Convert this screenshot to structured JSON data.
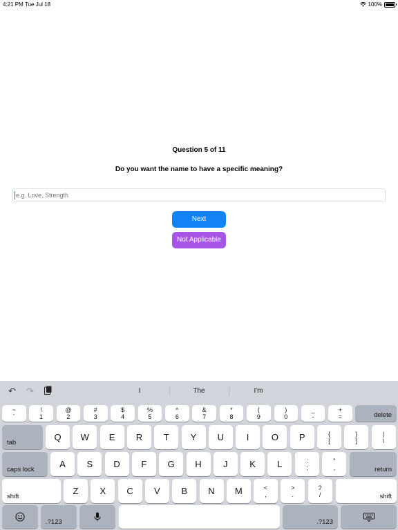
{
  "status_bar": {
    "time": "4:21 PM",
    "date": "Tue Jul 18",
    "battery": "100%"
  },
  "question": {
    "counter": "Question 5 of 11",
    "text": "Do you want the name to have a specific meaning?",
    "placeholder": "e.g. Love, Strength"
  },
  "buttons": {
    "next": "Next",
    "not_applicable": "Not Applicable"
  },
  "colors": {
    "next": "#1183f5",
    "not_applicable": "#a855e6",
    "keyboard_bg": "#d1d4da"
  },
  "keyboard": {
    "suggestions": [
      "I",
      "The",
      "I'm"
    ],
    "toolbar_icons": [
      "undo-icon",
      "redo-icon",
      "paste-icon"
    ],
    "number_row": [
      {
        "top": "~",
        "bot": "`"
      },
      {
        "top": "!",
        "bot": "1"
      },
      {
        "top": "@",
        "bot": "2"
      },
      {
        "top": "#",
        "bot": "3"
      },
      {
        "top": "$",
        "bot": "4"
      },
      {
        "top": "%",
        "bot": "5"
      },
      {
        "top": "^",
        "bot": "6"
      },
      {
        "top": "&",
        "bot": "7"
      },
      {
        "top": "*",
        "bot": "8"
      },
      {
        "top": "(",
        "bot": "9"
      },
      {
        "top": ")",
        "bot": "0"
      },
      {
        "top": "_",
        "bot": "-"
      },
      {
        "top": "+",
        "bot": "="
      }
    ],
    "delete": "delete",
    "tab": "tab",
    "row_q": [
      "Q",
      "W",
      "E",
      "R",
      "T",
      "Y",
      "U",
      "I",
      "O",
      "P"
    ],
    "row_q_symbols": [
      {
        "top": "{",
        "bot": "["
      },
      {
        "top": "}",
        "bot": "]"
      },
      {
        "top": "|",
        "bot": "\\"
      }
    ],
    "caps_lock": "caps lock",
    "row_a": [
      "A",
      "S",
      "D",
      "F",
      "G",
      "H",
      "J",
      "K",
      "L"
    ],
    "row_a_symbols": [
      {
        "top": ":",
        "bot": ";"
      },
      {
        "top": "\"",
        "bot": ","
      }
    ],
    "return": "return",
    "shift": "shift",
    "row_z": [
      "Z",
      "X",
      "C",
      "V",
      "B",
      "N",
      "M"
    ],
    "row_z_symbols": [
      {
        "top": "<",
        "bot": ","
      },
      {
        "top": ">",
        "bot": "."
      },
      {
        "top": "?",
        "bot": "/"
      }
    ],
    "numbers_key": ".?123",
    "bottom_icons": [
      "emoji-icon",
      "microphone-icon",
      "hide-keyboard-icon"
    ]
  }
}
